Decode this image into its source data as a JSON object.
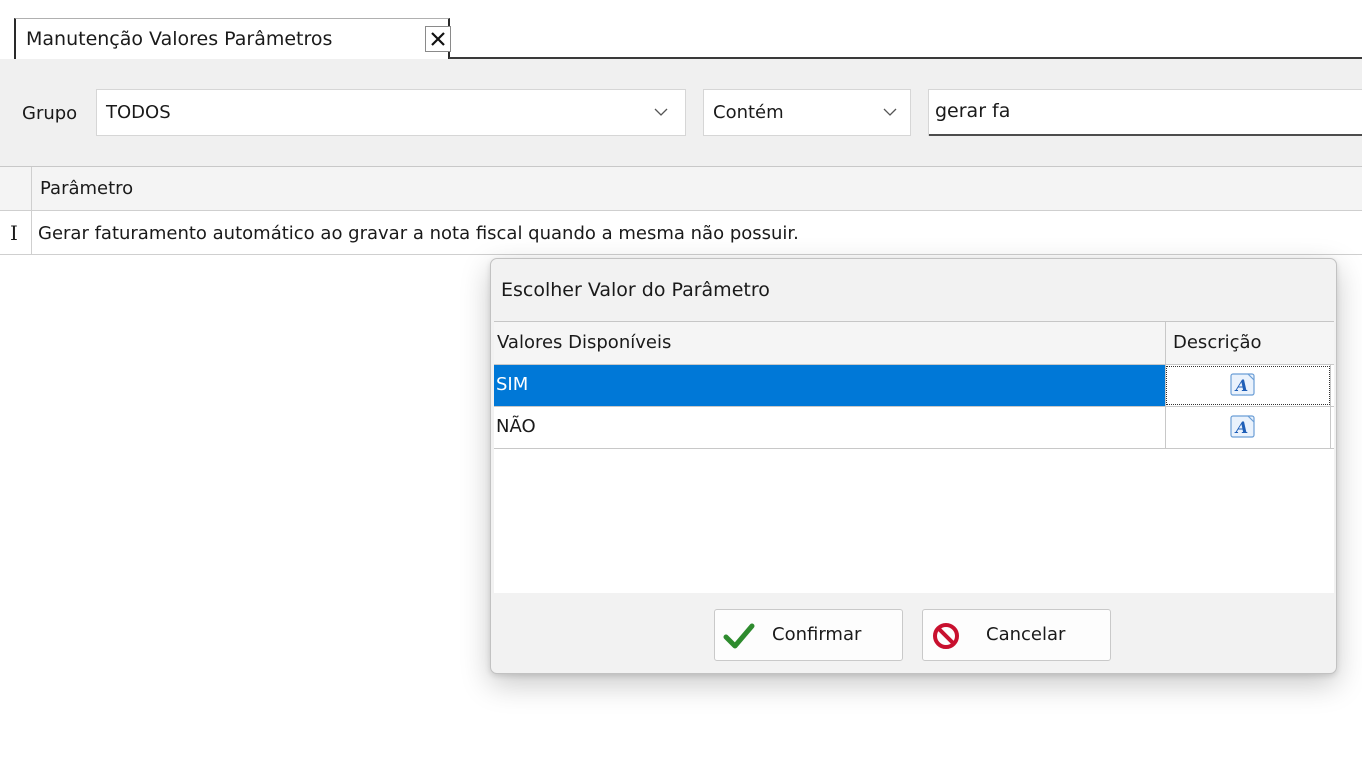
{
  "tab": {
    "title": "Manutenção Valores Parâmetros",
    "close_icon": "close-icon"
  },
  "filter": {
    "grupo_label": "Grupo",
    "grupo_value": "TODOS",
    "operator_value": "Contém",
    "search_value": "gerar fa"
  },
  "grid": {
    "column_header": "Parâmetro",
    "row_indicator": "I",
    "rows": [
      {
        "parametro": "Gerar faturamento automático ao gravar a nota fiscal quando a mesma não possuir."
      }
    ]
  },
  "dialog": {
    "title": "Escolher Valor do Parâmetro",
    "columns": [
      "Valores Disponíveis",
      "Descrição"
    ],
    "rows": [
      {
        "value": "SIM",
        "selected": true,
        "description_icon": "text-description-icon"
      },
      {
        "value": "NÃO",
        "selected": false,
        "description_icon": "text-description-icon"
      }
    ],
    "confirm_label": "Confirmar",
    "cancel_label": "Cancelar"
  },
  "colors": {
    "selection": "#0078d7",
    "confirm_icon": "#2e8b2e",
    "cancel_icon": "#c8102e",
    "filter_bar": "#f0f0f0"
  }
}
